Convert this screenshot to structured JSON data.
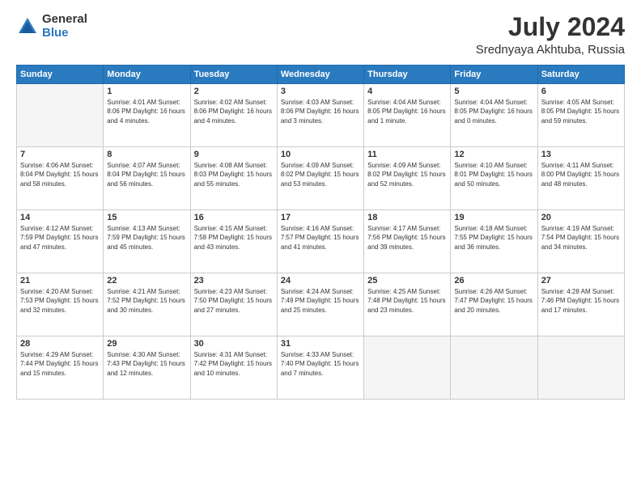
{
  "header": {
    "logo_general": "General",
    "logo_blue": "Blue",
    "title": "July 2024",
    "subtitle": "Srednyaya Akhtuba, Russia"
  },
  "weekdays": [
    "Sunday",
    "Monday",
    "Tuesday",
    "Wednesday",
    "Thursday",
    "Friday",
    "Saturday"
  ],
  "weeks": [
    [
      {
        "day": "",
        "info": ""
      },
      {
        "day": "1",
        "info": "Sunrise: 4:01 AM\nSunset: 8:06 PM\nDaylight: 16 hours\nand 4 minutes."
      },
      {
        "day": "2",
        "info": "Sunrise: 4:02 AM\nSunset: 8:06 PM\nDaylight: 16 hours\nand 4 minutes."
      },
      {
        "day": "3",
        "info": "Sunrise: 4:03 AM\nSunset: 8:06 PM\nDaylight: 16 hours\nand 3 minutes."
      },
      {
        "day": "4",
        "info": "Sunrise: 4:04 AM\nSunset: 8:05 PM\nDaylight: 16 hours\nand 1 minute."
      },
      {
        "day": "5",
        "info": "Sunrise: 4:04 AM\nSunset: 8:05 PM\nDaylight: 16 hours\nand 0 minutes."
      },
      {
        "day": "6",
        "info": "Sunrise: 4:05 AM\nSunset: 8:05 PM\nDaylight: 15 hours\nand 59 minutes."
      }
    ],
    [
      {
        "day": "7",
        "info": "Sunrise: 4:06 AM\nSunset: 8:04 PM\nDaylight: 15 hours\nand 58 minutes."
      },
      {
        "day": "8",
        "info": "Sunrise: 4:07 AM\nSunset: 8:04 PM\nDaylight: 15 hours\nand 56 minutes."
      },
      {
        "day": "9",
        "info": "Sunrise: 4:08 AM\nSunset: 8:03 PM\nDaylight: 15 hours\nand 55 minutes."
      },
      {
        "day": "10",
        "info": "Sunrise: 4:09 AM\nSunset: 8:02 PM\nDaylight: 15 hours\nand 53 minutes."
      },
      {
        "day": "11",
        "info": "Sunrise: 4:09 AM\nSunset: 8:02 PM\nDaylight: 15 hours\nand 52 minutes."
      },
      {
        "day": "12",
        "info": "Sunrise: 4:10 AM\nSunset: 8:01 PM\nDaylight: 15 hours\nand 50 minutes."
      },
      {
        "day": "13",
        "info": "Sunrise: 4:11 AM\nSunset: 8:00 PM\nDaylight: 15 hours\nand 48 minutes."
      }
    ],
    [
      {
        "day": "14",
        "info": "Sunrise: 4:12 AM\nSunset: 7:59 PM\nDaylight: 15 hours\nand 47 minutes."
      },
      {
        "day": "15",
        "info": "Sunrise: 4:13 AM\nSunset: 7:59 PM\nDaylight: 15 hours\nand 45 minutes."
      },
      {
        "day": "16",
        "info": "Sunrise: 4:15 AM\nSunset: 7:58 PM\nDaylight: 15 hours\nand 43 minutes."
      },
      {
        "day": "17",
        "info": "Sunrise: 4:16 AM\nSunset: 7:57 PM\nDaylight: 15 hours\nand 41 minutes."
      },
      {
        "day": "18",
        "info": "Sunrise: 4:17 AM\nSunset: 7:56 PM\nDaylight: 15 hours\nand 39 minutes."
      },
      {
        "day": "19",
        "info": "Sunrise: 4:18 AM\nSunset: 7:55 PM\nDaylight: 15 hours\nand 36 minutes."
      },
      {
        "day": "20",
        "info": "Sunrise: 4:19 AM\nSunset: 7:54 PM\nDaylight: 15 hours\nand 34 minutes."
      }
    ],
    [
      {
        "day": "21",
        "info": "Sunrise: 4:20 AM\nSunset: 7:53 PM\nDaylight: 15 hours\nand 32 minutes."
      },
      {
        "day": "22",
        "info": "Sunrise: 4:21 AM\nSunset: 7:52 PM\nDaylight: 15 hours\nand 30 minutes."
      },
      {
        "day": "23",
        "info": "Sunrise: 4:23 AM\nSunset: 7:50 PM\nDaylight: 15 hours\nand 27 minutes."
      },
      {
        "day": "24",
        "info": "Sunrise: 4:24 AM\nSunset: 7:49 PM\nDaylight: 15 hours\nand 25 minutes."
      },
      {
        "day": "25",
        "info": "Sunrise: 4:25 AM\nSunset: 7:48 PM\nDaylight: 15 hours\nand 23 minutes."
      },
      {
        "day": "26",
        "info": "Sunrise: 4:26 AM\nSunset: 7:47 PM\nDaylight: 15 hours\nand 20 minutes."
      },
      {
        "day": "27",
        "info": "Sunrise: 4:28 AM\nSunset: 7:46 PM\nDaylight: 15 hours\nand 17 minutes."
      }
    ],
    [
      {
        "day": "28",
        "info": "Sunrise: 4:29 AM\nSunset: 7:44 PM\nDaylight: 15 hours\nand 15 minutes."
      },
      {
        "day": "29",
        "info": "Sunrise: 4:30 AM\nSunset: 7:43 PM\nDaylight: 15 hours\nand 12 minutes."
      },
      {
        "day": "30",
        "info": "Sunrise: 4:31 AM\nSunset: 7:42 PM\nDaylight: 15 hours\nand 10 minutes."
      },
      {
        "day": "31",
        "info": "Sunrise: 4:33 AM\nSunset: 7:40 PM\nDaylight: 15 hours\nand 7 minutes."
      },
      {
        "day": "",
        "info": ""
      },
      {
        "day": "",
        "info": ""
      },
      {
        "day": "",
        "info": ""
      }
    ]
  ]
}
